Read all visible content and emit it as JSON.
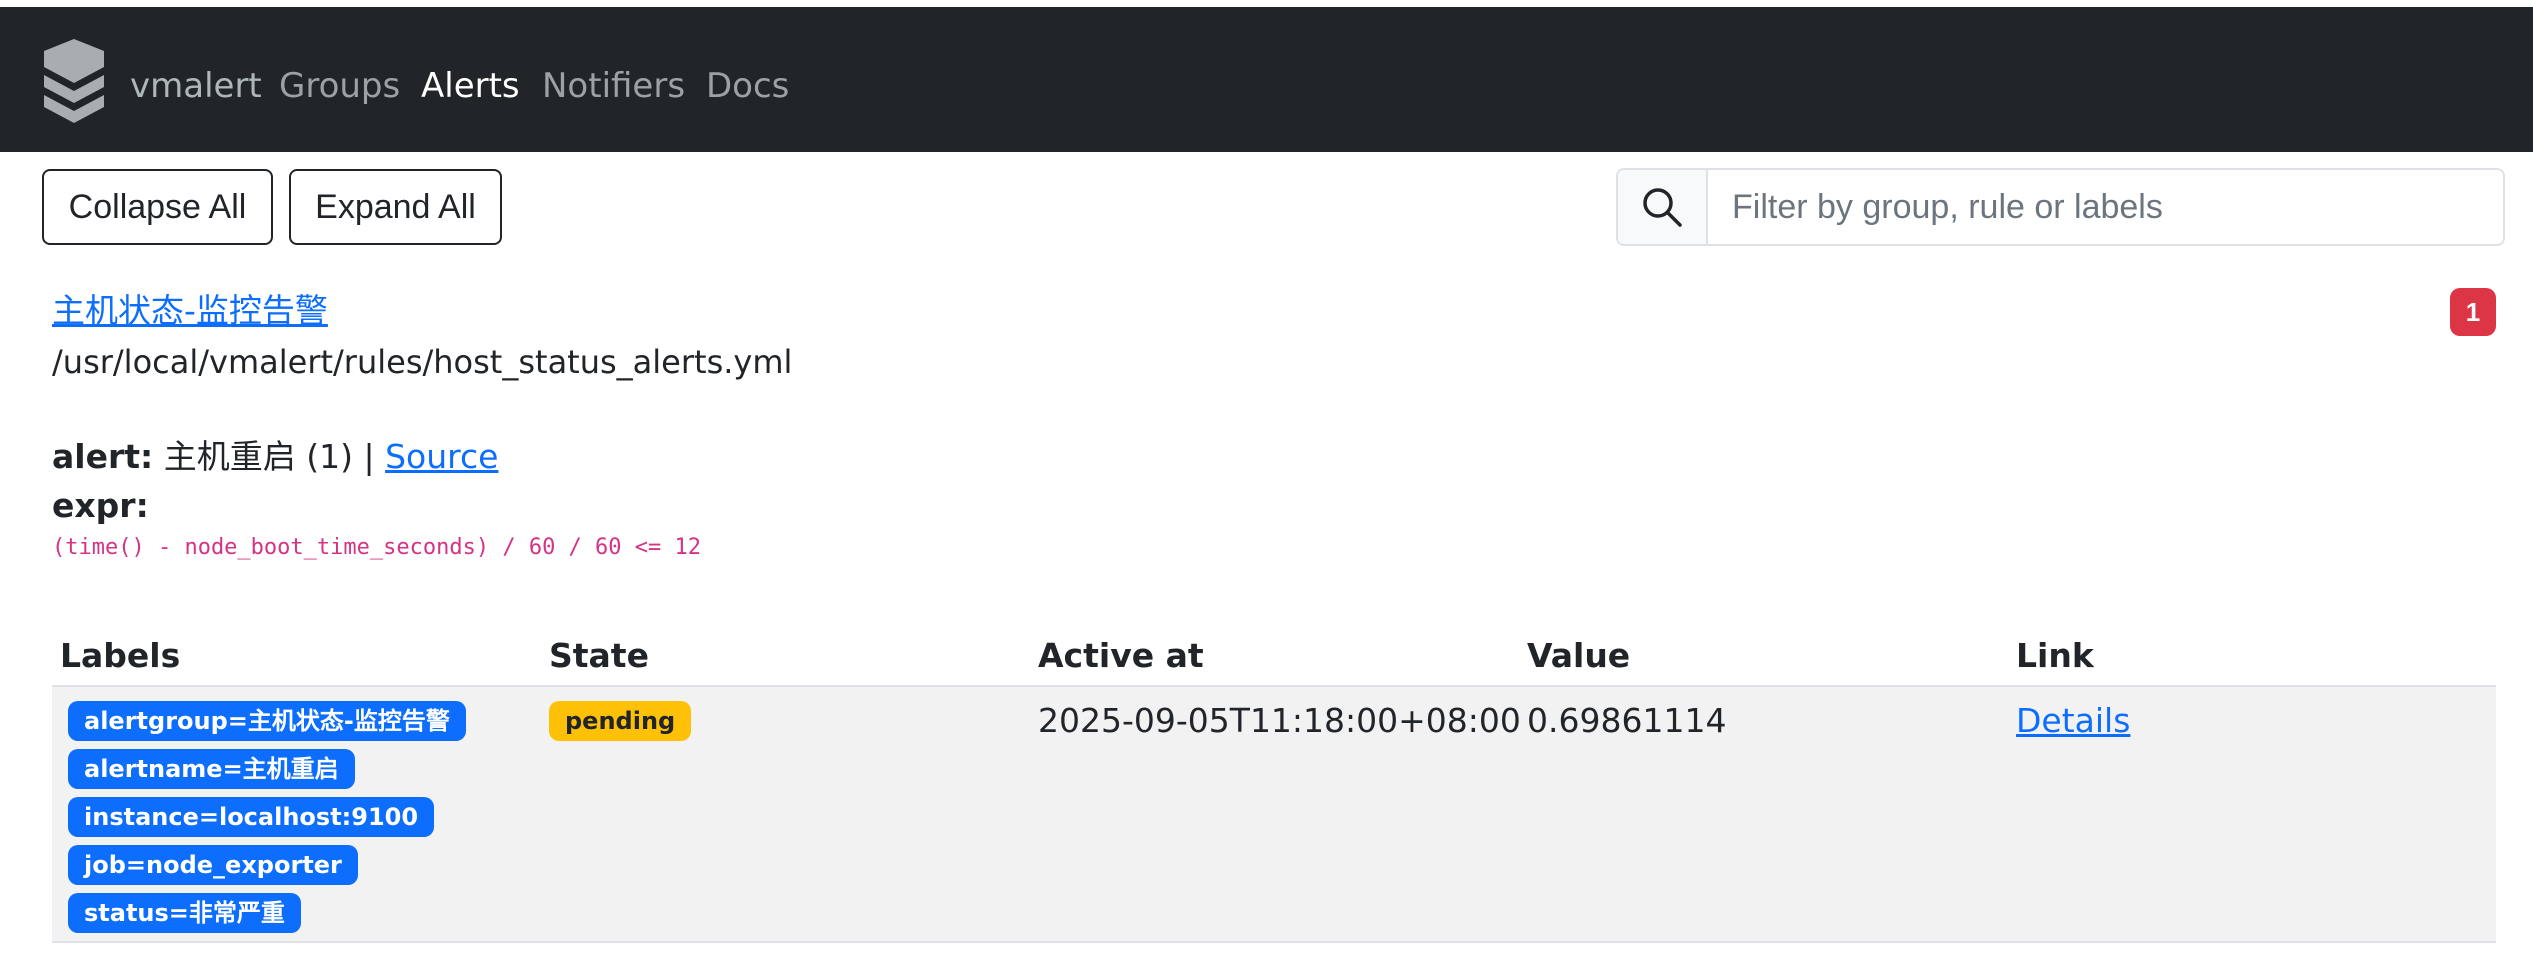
{
  "navbar": {
    "brand": "vmalert",
    "items": [
      "Groups",
      "Alerts",
      "Notifiers",
      "Docs"
    ],
    "active": "Alerts",
    "logo_icon": "vmalert-stack-logo"
  },
  "toolbar": {
    "collapse_label": "Collapse All",
    "expand_label": "Expand All"
  },
  "search": {
    "icon": "search-icon",
    "value": "",
    "placeholder": "Filter by group, rule or labels"
  },
  "group": {
    "name": "主机状态-监控告警",
    "file": "/usr/local/vmalert/rules/host_status_alerts.yml",
    "count": "1"
  },
  "alert": {
    "prefix": "alert:",
    "name": "主机重启 (1)",
    "separator": "|",
    "source_label": "Source",
    "expr_label": "expr:",
    "expr": "(time() - node_boot_time_seconds) / 60 / 60 <= 12"
  },
  "table": {
    "headers": [
      "Labels",
      "State",
      "Active at",
      "Value",
      "Link"
    ],
    "rows": [
      {
        "labels": [
          "alertgroup=主机状态-监控告警",
          "alertname=主机重启",
          "instance=localhost:9100",
          "job=node_exporter",
          "status=非常严重"
        ],
        "state": "pending",
        "active_at": "2025-09-05T11:18:00+08:00",
        "value": "0.69861114",
        "link": "Details"
      }
    ]
  },
  "colors": {
    "navbar_bg": "#212529",
    "link": "#0d6efd",
    "label_badge": "#0d6efd",
    "pending_badge": "#ffc107",
    "count_badge": "#dc3545",
    "expr_text": "#d63384"
  }
}
